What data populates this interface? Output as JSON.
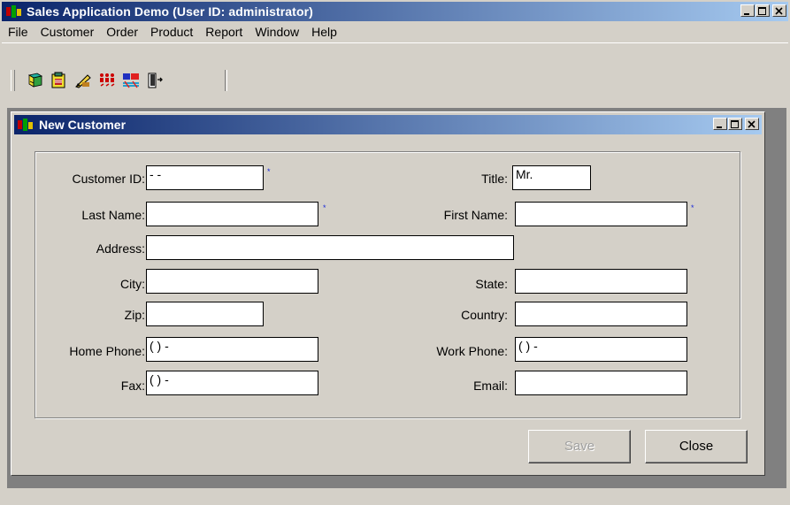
{
  "app": {
    "title": "Sales Application Demo (User ID: administrator)"
  },
  "menu": [
    "File",
    "Customer",
    "Order",
    "Product",
    "Report",
    "Window",
    "Help"
  ],
  "toolbar": {
    "tools": [
      "books-icon",
      "document-icon",
      "pencil-icon",
      "people-icon",
      "chart-icon",
      "exit-door-icon"
    ]
  },
  "child_window": {
    "title": "New Customer"
  },
  "form": {
    "customer_id": {
      "label": "Customer ID:",
      "value": " -  -"
    },
    "title": {
      "label": "Title:",
      "value": "Mr."
    },
    "last_name": {
      "label": "Last Name:",
      "value": ""
    },
    "first_name": {
      "label": "First Name:",
      "value": ""
    },
    "address": {
      "label": "Address:",
      "value": ""
    },
    "city": {
      "label": "City:",
      "value": ""
    },
    "state": {
      "label": "State:",
      "value": ""
    },
    "zip": {
      "label": "Zip:",
      "value": ""
    },
    "country": {
      "label": "Country:",
      "value": ""
    },
    "home_phone": {
      "label": "Home Phone:",
      "value": "(   )    -"
    },
    "work_phone": {
      "label": "Work Phone:",
      "value": "(   )    -"
    },
    "fax": {
      "label": "Fax:",
      "value": "(   )    -"
    },
    "email": {
      "label": "Email:",
      "value": ""
    },
    "required_marker": "*"
  },
  "buttons": {
    "save": "Save",
    "close": "Close"
  },
  "colors": {
    "title_gradient_start": "#0a246a",
    "title_gradient_end": "#a6caf0",
    "face": "#d4d0c8",
    "mdi_background": "#808080",
    "required_marker": "#1a2ad8"
  }
}
